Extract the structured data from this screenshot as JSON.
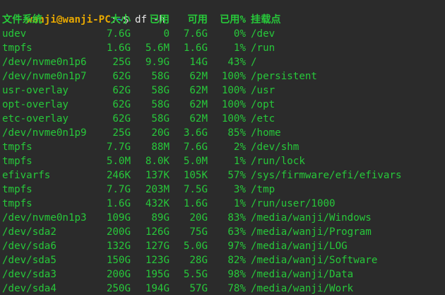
{
  "prompt": {
    "user_host": "wanji@wanji-PC",
    "separator": ":",
    "path": "~",
    "symbol": "$",
    "command": "df -h"
  },
  "table": {
    "headers": [
      "文件系统",
      "大小",
      "已用",
      "可用",
      "已用%",
      "挂载点"
    ],
    "rows": [
      [
        "udev",
        "7.6G",
        "0",
        "7.6G",
        "0%",
        "/dev"
      ],
      [
        "tmpfs",
        "1.6G",
        "5.6M",
        "1.6G",
        "1%",
        "/run"
      ],
      [
        "/dev/nvme0n1p6",
        "25G",
        "9.9G",
        "14G",
        "43%",
        "/"
      ],
      [
        "/dev/nvme0n1p7",
        "62G",
        "58G",
        "62M",
        "100%",
        "/persistent"
      ],
      [
        "usr-overlay",
        "62G",
        "58G",
        "62M",
        "100%",
        "/usr"
      ],
      [
        "opt-overlay",
        "62G",
        "58G",
        "62M",
        "100%",
        "/opt"
      ],
      [
        "etc-overlay",
        "62G",
        "58G",
        "62M",
        "100%",
        "/etc"
      ],
      [
        "/dev/nvme0n1p9",
        "25G",
        "20G",
        "3.6G",
        "85%",
        "/home"
      ],
      [
        "tmpfs",
        "7.7G",
        "88M",
        "7.6G",
        "2%",
        "/dev/shm"
      ],
      [
        "tmpfs",
        "5.0M",
        "8.0K",
        "5.0M",
        "1%",
        "/run/lock"
      ],
      [
        "efivarfs",
        "246K",
        "137K",
        "105K",
        "57%",
        "/sys/firmware/efi/efivars"
      ],
      [
        "tmpfs",
        "7.7G",
        "203M",
        "7.5G",
        "3%",
        "/tmp"
      ],
      [
        "tmpfs",
        "1.6G",
        "432K",
        "1.6G",
        "1%",
        "/run/user/1000"
      ],
      [
        "/dev/nvme0n1p3",
        "109G",
        "89G",
        "20G",
        "83%",
        "/media/wanji/Windows"
      ],
      [
        "/dev/sda2",
        "200G",
        "126G",
        "75G",
        "63%",
        "/media/wanji/Program"
      ],
      [
        "/dev/sda6",
        "132G",
        "127G",
        "5.0G",
        "97%",
        "/media/wanji/LOG"
      ],
      [
        "/dev/sda5",
        "150G",
        "123G",
        "28G",
        "82%",
        "/media/wanji/Software"
      ],
      [
        "/dev/sda3",
        "200G",
        "195G",
        "5.5G",
        "98%",
        "/media/wanji/Data"
      ],
      [
        "/dev/sda4",
        "250G",
        "194G",
        "57G",
        "78%",
        "/media/wanji/Work"
      ]
    ]
  },
  "colors": {
    "background": "#2b2b2b",
    "output_text": "#27c83a",
    "user_host": "#e8a800",
    "path": "#3a8ee6",
    "command": "#e6e6e6"
  }
}
